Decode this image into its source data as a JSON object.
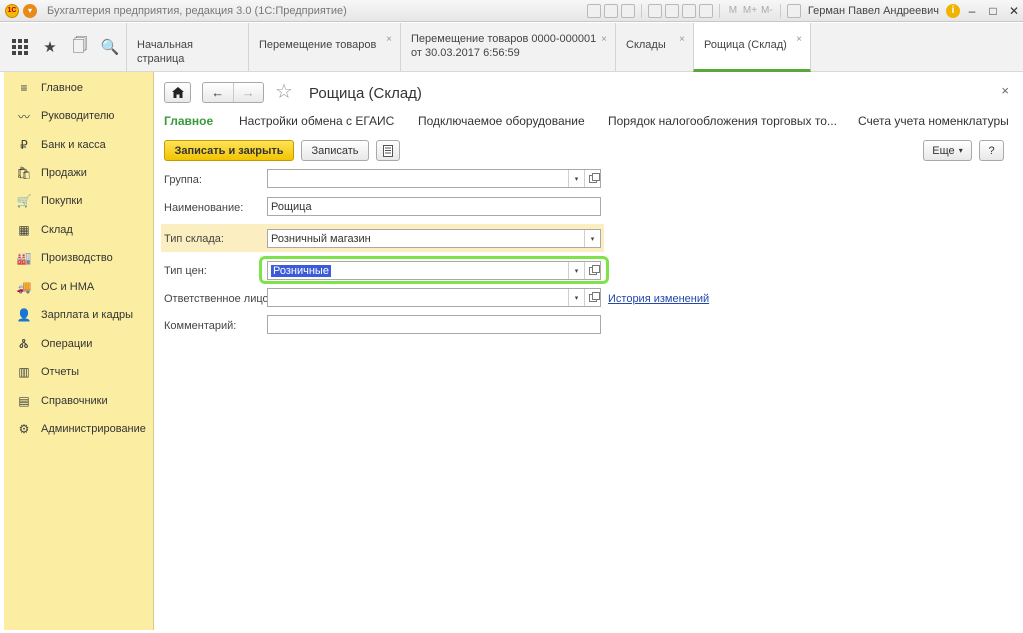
{
  "titlebar": {
    "logo": "1С",
    "title": "Бухгалтерия предприятия, редакция 3.0  (1С:Предприятие)",
    "tool_m_labels": [
      "M",
      "M+",
      "M-"
    ],
    "user": "Герман Павел Андреевич",
    "info": "i",
    "minimize": "–",
    "maximize": "□",
    "close": "✕"
  },
  "iconbar": {
    "icons": [
      "apps-grid-icon",
      "star-icon",
      "history-icon",
      "search-icon"
    ],
    "star": "★",
    "history": "🗍",
    "search": "🔍"
  },
  "tabs": [
    {
      "label": "Начальная страница",
      "closable": false
    },
    {
      "label": "Перемещение товаров",
      "closable": true
    },
    {
      "label": "Перемещение товаров 0000-000001",
      "label2": "от 30.03.2017 6:56:59",
      "closable": true
    },
    {
      "label": "Склады",
      "closable": true
    },
    {
      "label": "Рощица (Склад)",
      "closable": true,
      "active": true
    }
  ],
  "tab_close": "×",
  "sidebar": {
    "items": [
      {
        "label": "Главное",
        "icon": "≡"
      },
      {
        "label": "Руководителю",
        "icon": "〰"
      },
      {
        "label": "Банк и касса",
        "icon": "₽"
      },
      {
        "label": "Продажи",
        "icon": "🛍"
      },
      {
        "label": "Покупки",
        "icon": "🛒"
      },
      {
        "label": "Склад",
        "icon": "▦"
      },
      {
        "label": "Производство",
        "icon": "🏭"
      },
      {
        "label": "ОС и НМА",
        "icon": "🚚"
      },
      {
        "label": "Зарплата и кадры",
        "icon": "👤"
      },
      {
        "label": "Операции",
        "icon": "Ꮬ"
      },
      {
        "label": "Отчеты",
        "icon": "▥"
      },
      {
        "label": "Справочники",
        "icon": "▤"
      },
      {
        "label": "Администрирование",
        "icon": "⚙"
      }
    ]
  },
  "form": {
    "title": "Рощица (Склад)",
    "close": "×",
    "nav_back": "←",
    "nav_forward": "→",
    "favorite": "☆",
    "tabs": [
      {
        "label": "Главное",
        "active": true
      },
      {
        "label": "Настройки обмена с ЕГАИС"
      },
      {
        "label": "Подключаемое оборудование"
      },
      {
        "label": "Порядок налогообложения торговых то..."
      },
      {
        "label": "Счета учета номенклатуры"
      }
    ],
    "buttons": {
      "save_close": "Записать и закрыть",
      "save": "Записать",
      "more": "Еще",
      "more_arrow": "▾",
      "help": "?"
    },
    "fields": {
      "group": {
        "label": "Группа:",
        "value": ""
      },
      "name": {
        "label": "Наименование:",
        "value": "Рощица"
      },
      "warehouse_type": {
        "label": "Тип склада:",
        "value": "Розничный магазин"
      },
      "price_type": {
        "label": "Тип цен:",
        "value": "Розничные"
      },
      "responsible": {
        "label": "Ответственное лицо:",
        "value": ""
      },
      "comment": {
        "label": "Комментарий:",
        "value": ""
      }
    },
    "history_link": "История изменений",
    "dropdown_arrow": "▾"
  }
}
